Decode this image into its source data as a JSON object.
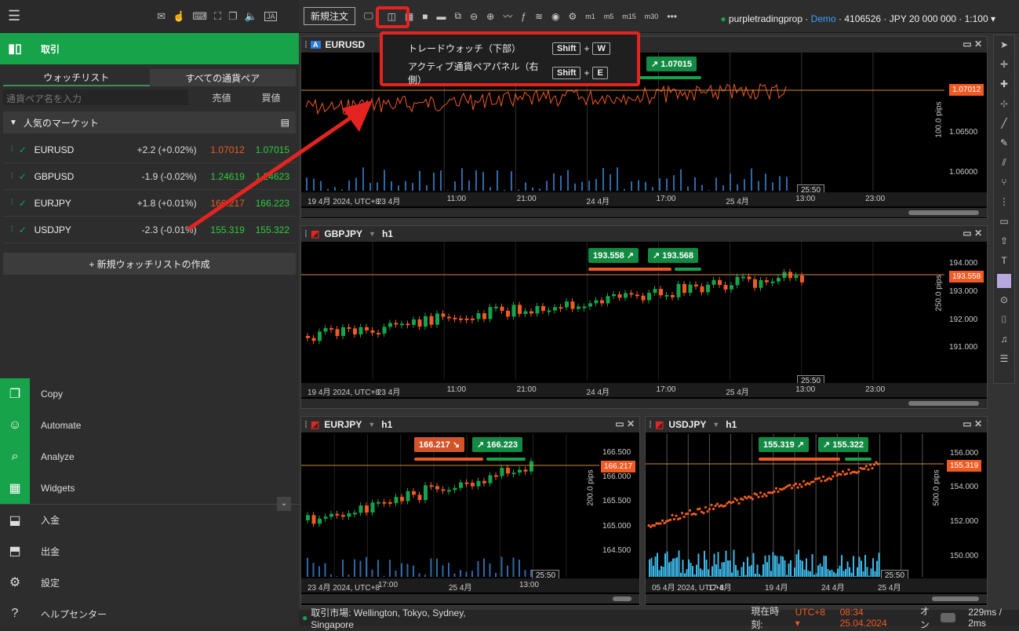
{
  "sidebar": {
    "top_icons": [
      "menu-icon",
      "mail-icon",
      "touch-icon",
      "keyboard-icon",
      "fullscreen-icon",
      "window-icon",
      "sound-icon",
      "ja-icon"
    ],
    "ja_label": "JA",
    "trade_label": "取引",
    "tab_watchlist": "ウォッチリスト",
    "tab_all_pairs": "すべての通貨ペア",
    "search_placeholder": "通貨ペア名を入力",
    "col_bid": "売値",
    "col_ask": "買値",
    "market_header": "人気のマーケット",
    "rows": [
      {
        "sym": "EURUSD",
        "chg": "+2.2 (+0.02%)",
        "bid": "1.07012",
        "ask": "1.07015",
        "bid_color": "#f05a24"
      },
      {
        "sym": "GBPUSD",
        "chg": "-1.9 (-0.02%)",
        "bid": "1.24619",
        "ask": "1.24623",
        "bid_color": "#2ecc40"
      },
      {
        "sym": "EURJPY",
        "chg": "+1.8 (+0.01%)",
        "bid": "166.217",
        "ask": "166.223",
        "bid_color": "#f05a24"
      },
      {
        "sym": "USDJPY",
        "chg": "-2.3 (-0.01%)",
        "bid": "155.319",
        "ask": "155.322",
        "bid_color": "#2ecc40"
      }
    ],
    "new_watchlist": "+ 新規ウォッチリストの作成",
    "menu": [
      {
        "label": "Copy",
        "icon": "copy-icon",
        "green": true
      },
      {
        "label": "Automate",
        "icon": "robot-icon",
        "green": true
      },
      {
        "label": "Analyze",
        "icon": "analyze-icon",
        "green": true
      },
      {
        "label": "Widgets",
        "icon": "widgets-icon",
        "green": true
      },
      {
        "label": "入金",
        "icon": "deposit-icon",
        "green": false
      },
      {
        "label": "出金",
        "icon": "withdraw-icon",
        "green": false
      },
      {
        "label": "設定",
        "icon": "gear-icon",
        "green": false
      },
      {
        "label": "ヘルプセンター",
        "icon": "help-icon",
        "green": false
      }
    ]
  },
  "toolbar": {
    "new_order": "新規注文",
    "tf_labels": [
      "m1",
      "m5",
      "m15",
      "m30"
    ],
    "account": "purpletradingprop",
    "demo": "Demo",
    "account_rest": "· 4106526 · JPY 20 000 000 · 1:100"
  },
  "popup": {
    "item1": "トレードウォッチ（下部）",
    "item1_key1": "Shift",
    "item1_key2": "W",
    "item2": "アクティブ通貨ペアパネル（右側）",
    "item2_key1": "Shift",
    "item2_key2": "E",
    "plus": "+"
  },
  "charts": {
    "eurusd": {
      "sym": "EURUSD",
      "bid": "1.07012",
      "ask": "1.07015",
      "pips": "100.0 pips",
      "price_tag": "1.07012",
      "ticks": [
        "1.06500",
        "1.06000"
      ],
      "x": [
        "19 4月 2024, UTC+8",
        "23 4月",
        "11:00",
        "21:00",
        "24 4月",
        "17:00",
        "25 4月",
        "13:00",
        "23:00"
      ],
      "timebox": "25:50"
    },
    "gbpjpy": {
      "sym": "GBPJPY",
      "tf": "h1",
      "bid": "193.558",
      "ask": "193.568",
      "pips": "250.0 pips",
      "price_tag": "193.558",
      "ticks": [
        "194.000",
        "193.000",
        "192.000",
        "191.000"
      ],
      "x": [
        "19 4月 2024, UTC+8",
        "23 4月",
        "11:00",
        "21:00",
        "24 4月",
        "17:00",
        "25 4月",
        "13:00",
        "23:00"
      ],
      "timebox": "25:50"
    },
    "eurjpy": {
      "sym": "EURJPY",
      "tf": "h1",
      "bid": "166.217",
      "ask": "166.223",
      "pips": "200.0 pips",
      "price_tag": "166.217",
      "ticks": [
        "166.500",
        "166.000",
        "165.500",
        "165.000",
        "164.500"
      ],
      "x": [
        "23 4月 2024, UTC+8",
        "17:00",
        "25 4月",
        "13:00"
      ],
      "timebox": "25:50"
    },
    "usdjpy": {
      "sym": "USDJPY",
      "tf": "h1",
      "bid": "155.319",
      "ask": "155.322",
      "pips": "500.0 pips",
      "price_tag": "155.319",
      "ticks": [
        "156.000",
        "154.000",
        "152.000",
        "150.000"
      ],
      "x": [
        "05 4月 2024, UTC+8",
        "17 4月",
        "19 4月",
        "24 4月",
        "25 4月"
      ],
      "timebox": "25:50"
    }
  },
  "status": {
    "market": "取引市場: Wellington, Tokyo, Sydney, Singapore",
    "time_label": "現在時刻:",
    "tz": "UTC+8 ▾",
    "datetime": "08:34 25.04.2024",
    "on": "オン",
    "latency": "229ms / 2ms"
  }
}
